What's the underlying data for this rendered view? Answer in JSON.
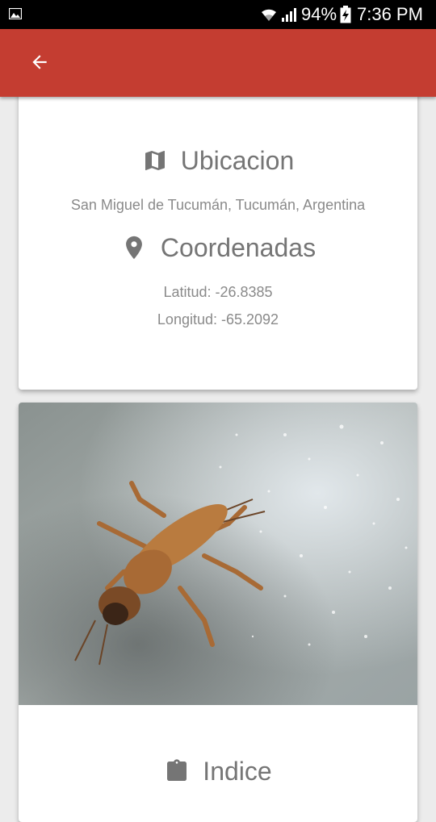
{
  "status_bar": {
    "battery": "94%",
    "time": "7:36 PM"
  },
  "app_bar": {
    "back_icon": "arrow-back-icon",
    "color": "#c43d31"
  },
  "location_card": {
    "ubicacion_icon": "map-icon",
    "ubicacion_title": "Ubicacion",
    "address": "San Miguel de Tucumán, Tucumán, Argentina",
    "coordenadas_icon": "place-marker-icon",
    "coordenadas_title": "Coordenadas",
    "latitud": "Latitud: -26.8385",
    "longitud": "Longitud: -65.2092"
  },
  "photo_card": {
    "image": "insect-on-rock-photo",
    "next_section_icon": "clipboard-icon",
    "next_section_title_partial": "Indice"
  }
}
